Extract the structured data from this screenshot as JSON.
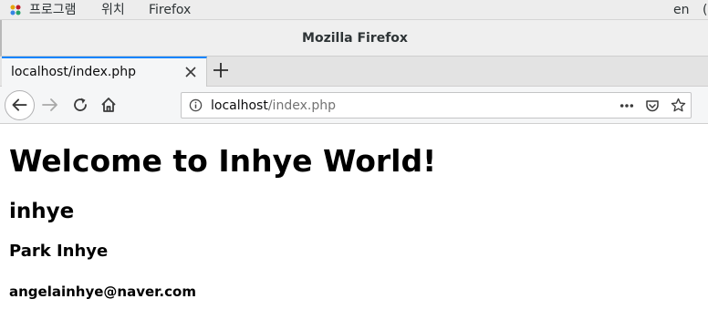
{
  "system_bar": {
    "applications_label": "프로그램",
    "places_label": "위치",
    "active_app_label": "Firefox",
    "language_label": "en",
    "right_edge_glyph": "("
  },
  "window": {
    "title": "Mozilla Firefox"
  },
  "tabs": [
    {
      "label": "localhost/index.php",
      "active": true
    }
  ],
  "url": {
    "host": "localhost",
    "path": "/index.php"
  },
  "page": {
    "heading_1": "Welcome to Inhye World!",
    "heading_2": "inhye",
    "heading_3": "Park Inhye",
    "heading_4": "angelainhye@naver.com"
  },
  "icons": {
    "apps": "applications-menu-icon",
    "close_tab": "close-icon",
    "new_tab": "plus-icon",
    "back": "back-arrow-icon",
    "forward": "forward-arrow-icon",
    "reload": "reload-icon",
    "home": "home-icon",
    "site_info": "info-icon",
    "page_actions": "more-dots-icon",
    "pocket": "pocket-icon",
    "bookmark": "star-icon"
  }
}
